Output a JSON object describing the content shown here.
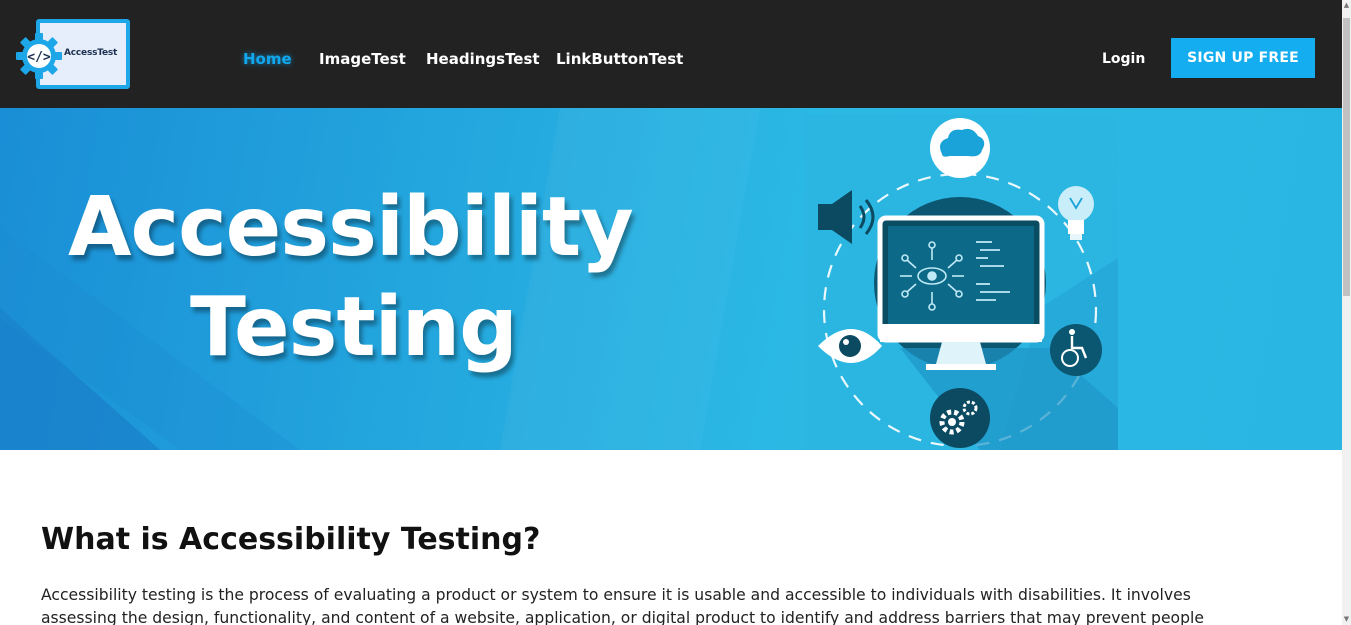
{
  "header": {
    "logo_text": "AccessTest",
    "nav": [
      {
        "label": "Home",
        "active": true
      },
      {
        "label": "ImageTest",
        "active": false
      },
      {
        "label": "HeadingsTest",
        "active": false
      },
      {
        "label": "LinkButtonTest",
        "active": false
      }
    ],
    "login_label": "Login",
    "signup_label": "SIGN UP FREE"
  },
  "hero": {
    "line1": "Accessibility",
    "line2": "Testing",
    "icons": [
      "brain-icon",
      "lightbulb-icon",
      "speaker-icon",
      "monitor-icon",
      "eye-icon",
      "wheelchair-icon",
      "gears-icon"
    ]
  },
  "content": {
    "title": "What is Accessibility Testing?",
    "body": "Accessibility testing is the process of evaluating a product or system to ensure it is usable and accessible to individuals with disabilities. It involves assessing the design, functionality, and content of a website, application, or digital product to identify and address barriers that may prevent people with disabilities"
  },
  "colors": {
    "header_bg": "#222222",
    "accent": "#14aef0",
    "hero_bg": "#2bb9e4"
  }
}
